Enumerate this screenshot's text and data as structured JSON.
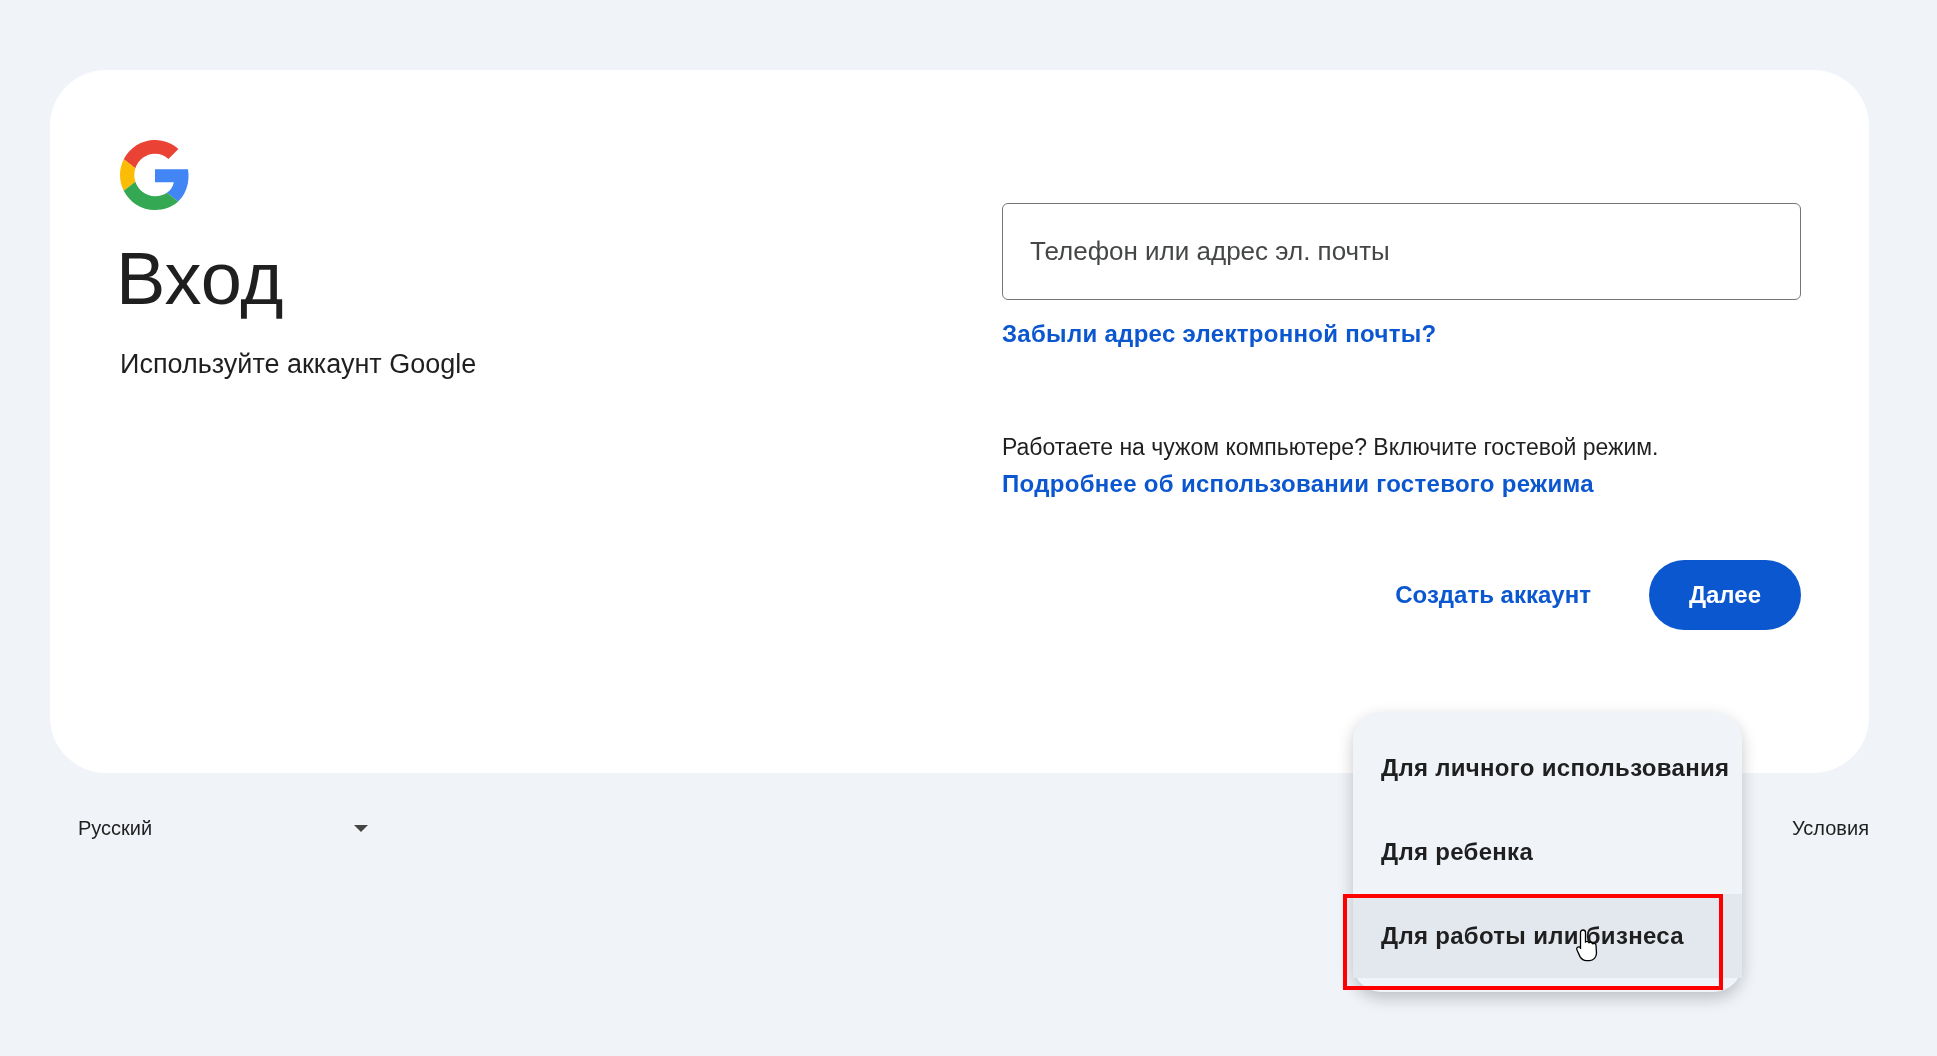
{
  "title": "Вход",
  "subtitle": "Используйте аккаунт Google",
  "email_field": {
    "placeholder": "Телефон или адрес эл. почты"
  },
  "forgot_link": "Забыли адрес электронной почты?",
  "guest_note": "Работаете на чужом компьютере? Включите гостевой режим.",
  "guest_link": "Подробнее об использовании гостевого режима",
  "create_account": "Создать аккаунт",
  "next_button": "Далее",
  "create_menu": {
    "items": [
      {
        "label": "Для личного использования",
        "selected": false,
        "annotated": false
      },
      {
        "label": "Для ребенка",
        "selected": false,
        "annotated": false
      },
      {
        "label": "Для работы или бизнеса",
        "selected": true,
        "annotated": true
      }
    ]
  },
  "footer": {
    "language": "Русский",
    "links": [
      "Условия"
    ]
  }
}
